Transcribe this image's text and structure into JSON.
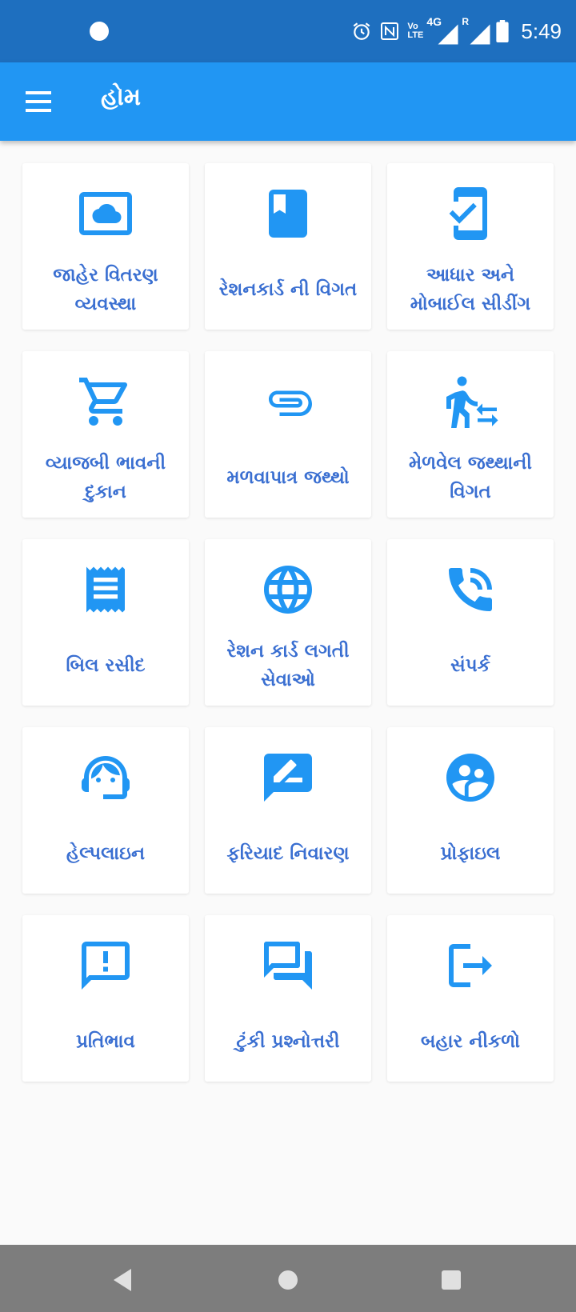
{
  "status_bar": {
    "time": "5:49",
    "volte_top": "Vo",
    "volte_bottom": "LTE",
    "network": "4G",
    "roaming": "R"
  },
  "app_bar": {
    "title": "હોમ",
    "menu_icon": "hamburger-menu-icon"
  },
  "tiles": [
    {
      "label": "જાહેર વિતરણ વ્યવસ્થા",
      "icon": "cloud-screen-icon"
    },
    {
      "label": "રેશનકાર્ડ ની વિગત",
      "icon": "book-bookmark-icon"
    },
    {
      "label": "આધાર અને મોબાઈલ સીડીંગ",
      "icon": "phone-check-icon"
    },
    {
      "label": "વ્યાજબી ભાવની દુકાન",
      "icon": "shopping-cart-icon"
    },
    {
      "label": "મળવાપાત્ર જથ્થો",
      "icon": "paperclip-icon"
    },
    {
      "label": "મેળવેલ જથ્થાની વિગત",
      "icon": "person-transfer-icon"
    },
    {
      "label": "બિલ રસીદ",
      "icon": "receipt-icon"
    },
    {
      "label": "રેશન કાર્ડ લગતી સેવાઓ",
      "icon": "globe-icon"
    },
    {
      "label": "સંપર્ક",
      "icon": "phone-call-icon"
    },
    {
      "label": "હેલ્પલાઇન",
      "icon": "headset-agent-icon"
    },
    {
      "label": "ફરિયાદ નિવારણ",
      "icon": "feedback-edit-icon"
    },
    {
      "label": "પ્રોફાઇલ",
      "icon": "profile-people-icon"
    },
    {
      "label": "પ્રતિભાવ",
      "icon": "feedback-alert-icon"
    },
    {
      "label": "ટુંકી પ્રશ્નોત્તરી",
      "icon": "forum-chat-icon"
    },
    {
      "label": "બહાર નીકળો",
      "icon": "exit-logout-icon"
    }
  ],
  "nav_bar": {
    "back_icon": "back-triangle-icon",
    "home_icon": "home-circle-icon",
    "recents_icon": "recents-square-icon"
  },
  "colors": {
    "status_bar": "#1e6fbf",
    "app_bar": "#2196f3",
    "icon": "#2196f3",
    "label_text": "#3a6fd1",
    "nav_bar": "#7d7d7d"
  }
}
